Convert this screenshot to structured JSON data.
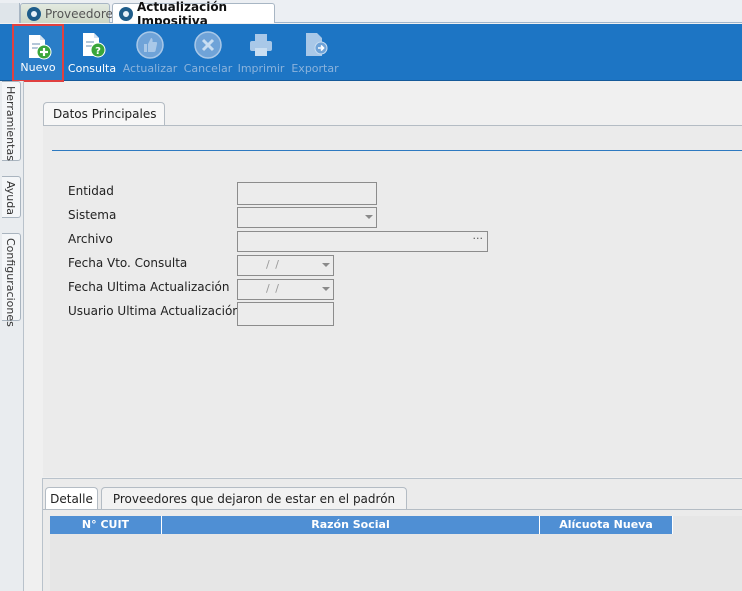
{
  "doc_tabs": [
    {
      "label": "Proveedores",
      "active": false
    },
    {
      "label": "Actualización Impositiva",
      "active": true
    }
  ],
  "toolbar": {
    "buttons": [
      {
        "id": "nuevo",
        "label": "Nuevo",
        "enabled": true,
        "icon": "document-add-icon"
      },
      {
        "id": "consulta",
        "label": "Consulta",
        "enabled": true,
        "icon": "document-help-icon"
      },
      {
        "id": "actualizar",
        "label": "Actualizar",
        "enabled": false,
        "icon": "thumbs-up-icon"
      },
      {
        "id": "cancelar",
        "label": "Cancelar",
        "enabled": false,
        "icon": "cancel-icon"
      },
      {
        "id": "imprimir",
        "label": "Imprimir",
        "enabled": false,
        "icon": "printer-icon"
      },
      {
        "id": "exportar",
        "label": "Exportar",
        "enabled": false,
        "icon": "export-icon"
      }
    ]
  },
  "side_tabs": [
    "Herramientas",
    "Ayuda",
    "Configuraciones"
  ],
  "main_tab": "Datos Principales",
  "form": {
    "entidad": {
      "label": "Entidad",
      "value": ""
    },
    "sistema": {
      "label": "Sistema",
      "value": ""
    },
    "archivo": {
      "label": "Archivo",
      "value": "",
      "browse": "···"
    },
    "fecha_vto": {
      "label": "Fecha Vto. Consulta",
      "value": "/ /"
    },
    "fecha_ult": {
      "label": "Fecha Ultima Actualización",
      "value": "/ /"
    },
    "usuario": {
      "label": "Usuario Ultima Actualización",
      "value": ""
    }
  },
  "detail_tabs": [
    "Detalle",
    "Proveedores que dejaron de estar en el padrón"
  ],
  "grid": {
    "columns": [
      "N° CUIT",
      "Razón Social",
      "Alícuota Nueva"
    ]
  },
  "colors": {
    "toolbar_bg": "#1d75c4",
    "grid_header": "#4f8fd4",
    "highlight": "#e04040"
  }
}
